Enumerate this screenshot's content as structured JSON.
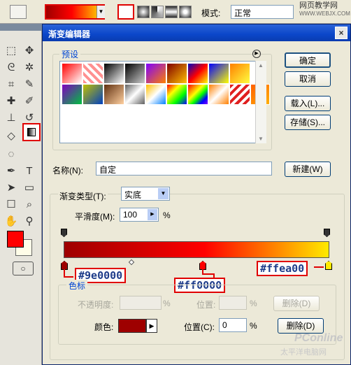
{
  "optionbar": {
    "mode_label": "模式:",
    "mode_value": "正常",
    "watermark": "网页教学网",
    "watermark_url": "WWW.WEBJX.COM"
  },
  "dialog": {
    "title": "渐变编辑器",
    "close": "×",
    "presets_label": "预设",
    "buttons": {
      "ok": "确定",
      "cancel": "取消",
      "load": "载入(L)...",
      "save": "存储(S)...",
      "new": "新建(W)"
    },
    "name_label": "名称(N):",
    "name_value": "自定",
    "gradient_type_label": "渐变类型(T):",
    "gradient_type_value": "实底",
    "smoothness_label": "平滑度(M):",
    "smoothness_value": "100",
    "percent": "%",
    "stops_label": "色标",
    "opacity_label": "不透明度:",
    "location_label": "位置:",
    "delete_label": "删除(D)",
    "color_label": "颜色:",
    "location_active_label": "位置(C):",
    "location_value": "0",
    "delete_active": "删除(D)"
  },
  "annotations": {
    "left_color": "#9e0000",
    "middle_color": "#ff0000",
    "right_color": "#ffea00"
  },
  "watermark_bottom": "PConline",
  "watermark_bottom2": "太平洋电脑网",
  "colors": {
    "stop_left": "#9e0000",
    "stop_mid": "#ff0000",
    "stop_right": "#ffea00",
    "title_bar": "#0b46c9",
    "highlight": "#e00000"
  }
}
